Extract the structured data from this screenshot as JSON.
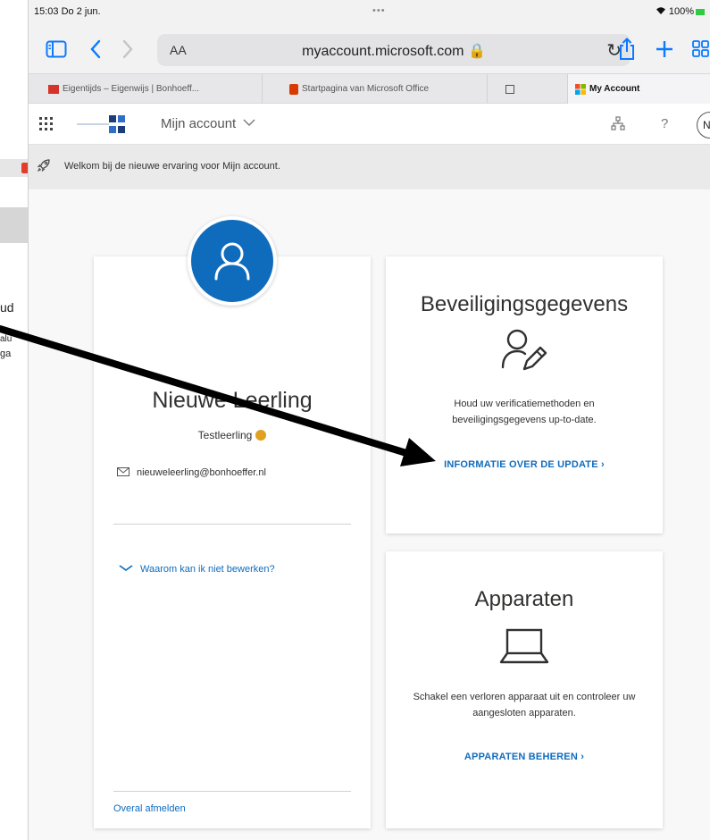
{
  "background_window": {
    "lines": [
      "ud",
      "alu",
      "ga"
    ]
  },
  "status_bar": {
    "time_date": "15:03  Do 2 jun.",
    "dots": "•••",
    "battery": "100%"
  },
  "toolbar": {
    "text_size": "AA",
    "url": "myaccount.microsoft.com 🔒",
    "reload": "↻"
  },
  "tabs": [
    {
      "label": "Eigentijds – Eigenwijs | Bonhoeff...",
      "favicon_color": "#d6332a",
      "active": false
    },
    {
      "label": "Startpagina van Microsoft Office",
      "favicon_color": "#d83b01",
      "active": false
    },
    {
      "label": "",
      "favicon_color": "#555555",
      "active": false
    },
    {
      "label": "My Account",
      "favicon_color": "#f25022",
      "active": true
    }
  ],
  "header": {
    "app_title": "Mijn account",
    "help": "?",
    "avatar_initial": "N"
  },
  "banner": {
    "text": "Welkom bij de nieuwe ervaring voor Mijn account."
  },
  "profile": {
    "name": "Nieuwe Leerling",
    "role": "Testleerling",
    "email": "nieuweleerling@bonhoeffer.nl",
    "why_link": "Waarom kan ik niet bewerken?",
    "signout_link": "Overal afmelden"
  },
  "security_card": {
    "title": "Beveiligingsgegevens",
    "description": "Houd uw verificatiemethoden en beveiligingsgegevens up-to-date.",
    "link": "INFORMATIE OVER DE UPDATE  ›"
  },
  "devices_card": {
    "title": "Apparaten",
    "description": "Schakel een verloren apparaat uit en controleer uw aangesloten apparaten.",
    "link": "APPARATEN BEHEREN  ›"
  },
  "colors": {
    "accent_blue": "#0f6cbd",
    "safari_blue": "#0a7aff",
    "arrow": "#000000"
  }
}
